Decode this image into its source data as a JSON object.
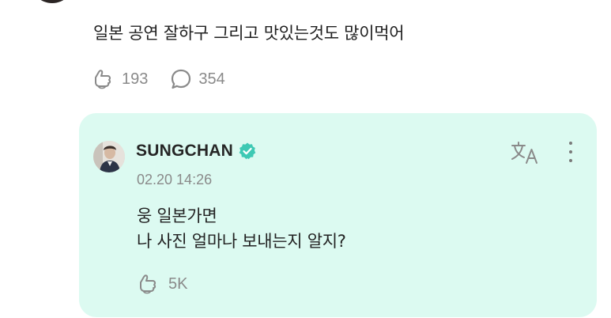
{
  "post": {
    "text": "일본 공연 잘하구 그리고 맛있는것도 많이먹어",
    "likes": "193",
    "comments": "354"
  },
  "reply": {
    "author": "SUNGCHAN",
    "time": "02.20 14:26",
    "body_lines": [
      "웅 일본가면",
      "나 사진 얼마나 보내는지 알지?"
    ],
    "likes": "5K",
    "translate_icon": "translate-icon",
    "verified_color": "#3ec9b4",
    "background": "#dcfaf1"
  }
}
